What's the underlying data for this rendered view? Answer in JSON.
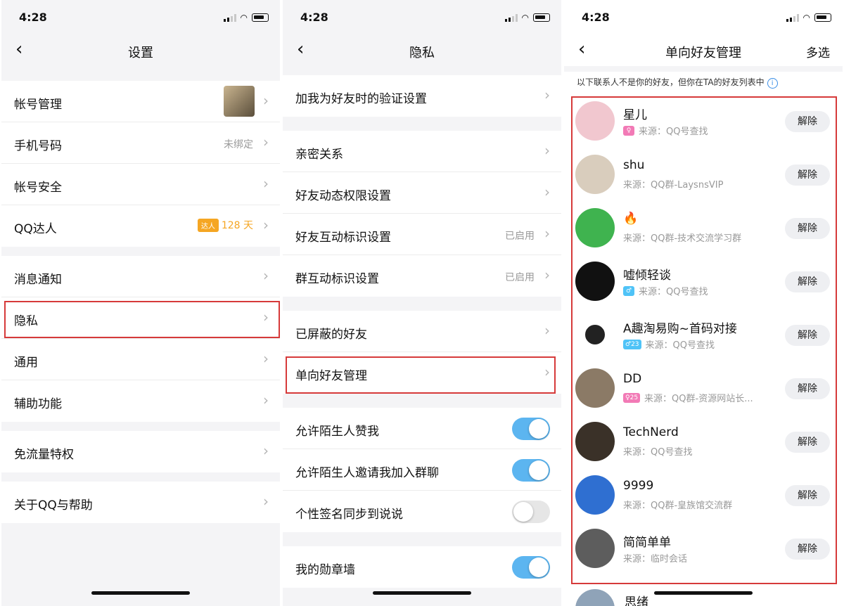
{
  "status": {
    "time": "4:28"
  },
  "settings": {
    "title": "设置",
    "items": [
      {
        "label": "帐号管理"
      },
      {
        "label": "手机号码",
        "value": "未绑定"
      },
      {
        "label": "帐号安全"
      },
      {
        "label": "QQ达人",
        "badge": "达人",
        "value": "128 天"
      },
      {
        "label": "消息通知"
      },
      {
        "label": "隐私"
      },
      {
        "label": "通用"
      },
      {
        "label": "辅助功能"
      },
      {
        "label": "免流量特权"
      },
      {
        "label": "关于QQ与帮助"
      }
    ]
  },
  "privacy": {
    "title": "隐私",
    "items": [
      {
        "label": "加我为好友时的验证设置"
      },
      {
        "label": "亲密关系"
      },
      {
        "label": "好友动态权限设置"
      },
      {
        "label": "好友互动标识设置",
        "value": "已启用"
      },
      {
        "label": "群互动标识设置",
        "value": "已启用"
      },
      {
        "label": "已屏蔽的好友"
      },
      {
        "label": "单向好友管理"
      },
      {
        "label": "允许陌生人赞我",
        "toggle": true
      },
      {
        "label": "允许陌生人邀请我加入群聊",
        "toggle": true
      },
      {
        "label": "个性签名同步到说说",
        "toggle": false
      },
      {
        "label": "我的勋章墙",
        "toggle": true
      }
    ]
  },
  "oneway": {
    "title": "单向好友管理",
    "multi_select": "多选",
    "notice": "以下联系人不是你的好友，但你在TA的好友列表中",
    "info_icon": "i",
    "unfriend_label": "解除",
    "friends": [
      {
        "name": "星儿",
        "tag": "♀",
        "tag_color": "pink",
        "source": "来源：QQ号查找",
        "avatar_color": "#f1c7cf"
      },
      {
        "name": "shu",
        "source": "来源：QQ群-LaysnsVIP",
        "avatar_color": "#d9cdbd"
      },
      {
        "name": "🔥",
        "source": "来源：QQ群-技术交流学习群",
        "avatar_color": "#3fb34f"
      },
      {
        "name": "嘘倾轻谈",
        "tag": "♂",
        "tag_color": "blue",
        "source": "来源：QQ号查找",
        "avatar_color": "#111111"
      },
      {
        "name": "A趣淘易购~首码对接",
        "tag": "♂23",
        "tag_color": "blue",
        "source": "来源：QQ号查找",
        "avatar_color": "#ffffff"
      },
      {
        "name": "DD",
        "tag": "♀25",
        "tag_color": "pink",
        "source": "来源：QQ群-资源网站长...",
        "avatar_color": "#8b7a66"
      },
      {
        "name": "TechNerd",
        "source": "来源：QQ号查找",
        "avatar_color": "#3a3128"
      },
      {
        "name": "9999",
        "source": "来源：QQ群-皇族馆交流群",
        "avatar_color": "#2f6fd1"
      },
      {
        "name": "简简单单",
        "source": "来源：临时会话",
        "avatar_color": "#5d5d5d"
      }
    ],
    "partial_name": "思绪"
  }
}
